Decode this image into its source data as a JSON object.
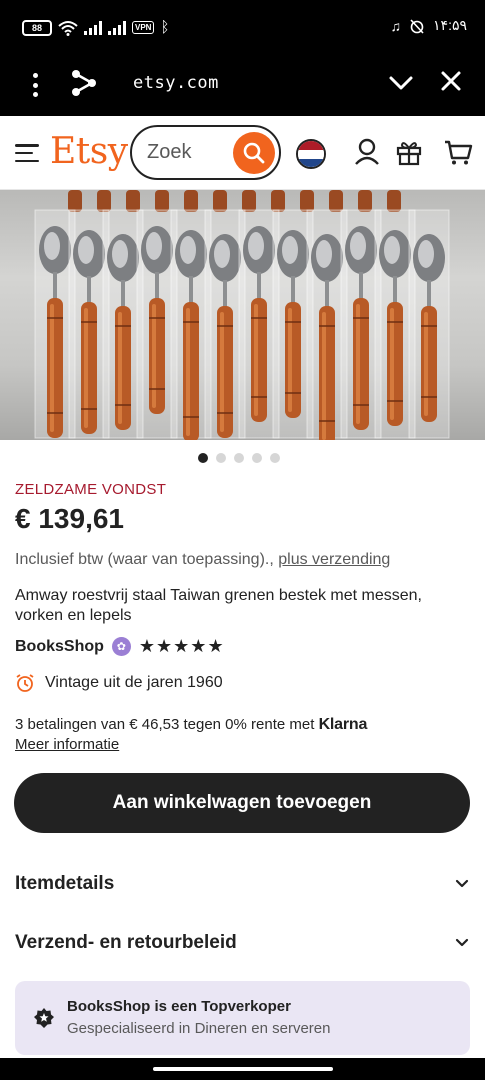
{
  "status_bar": {
    "battery": "88",
    "vpn": "VPN",
    "time": "۱۴:۵۹"
  },
  "browser": {
    "url": "etsy.com"
  },
  "header": {
    "logo": "Etsy",
    "search_placeholder": "Zoek"
  },
  "gallery": {
    "image_count": 5,
    "active_index": 0
  },
  "product": {
    "badge": "ZELDZAME VONDST",
    "price": "€ 139,61",
    "tax_note": "Inclusief btw (waar van toepassing).,",
    "shipping_link": "plus verzending",
    "title": "Amway roestvrij staal Taiwan grenen bestek met messen, vorken en lepels",
    "shop_name": "BooksShop",
    "rating": 5,
    "stars": "★★★★★",
    "vintage": "Vintage uit de jaren 1960",
    "klarna_text": "3 betalingen van € 46,53 tegen 0% rente met",
    "klarna_brand": "Klarna",
    "more_info": "Meer informatie",
    "add_to_cart": "Aan winkelwagen toevoegen"
  },
  "accordions": [
    {
      "label": "Itemdetails"
    },
    {
      "label": "Verzend- en retourbeleid"
    }
  ],
  "top_seller": {
    "title": "BooksShop is een Topverkoper",
    "subtitle": "Gespecialiseerd in Dineren en serveren"
  },
  "colors": {
    "accent": "#f1641e",
    "badge": "#a61a2e",
    "button": "#222222",
    "topseller_bg": "#eae6f4"
  }
}
